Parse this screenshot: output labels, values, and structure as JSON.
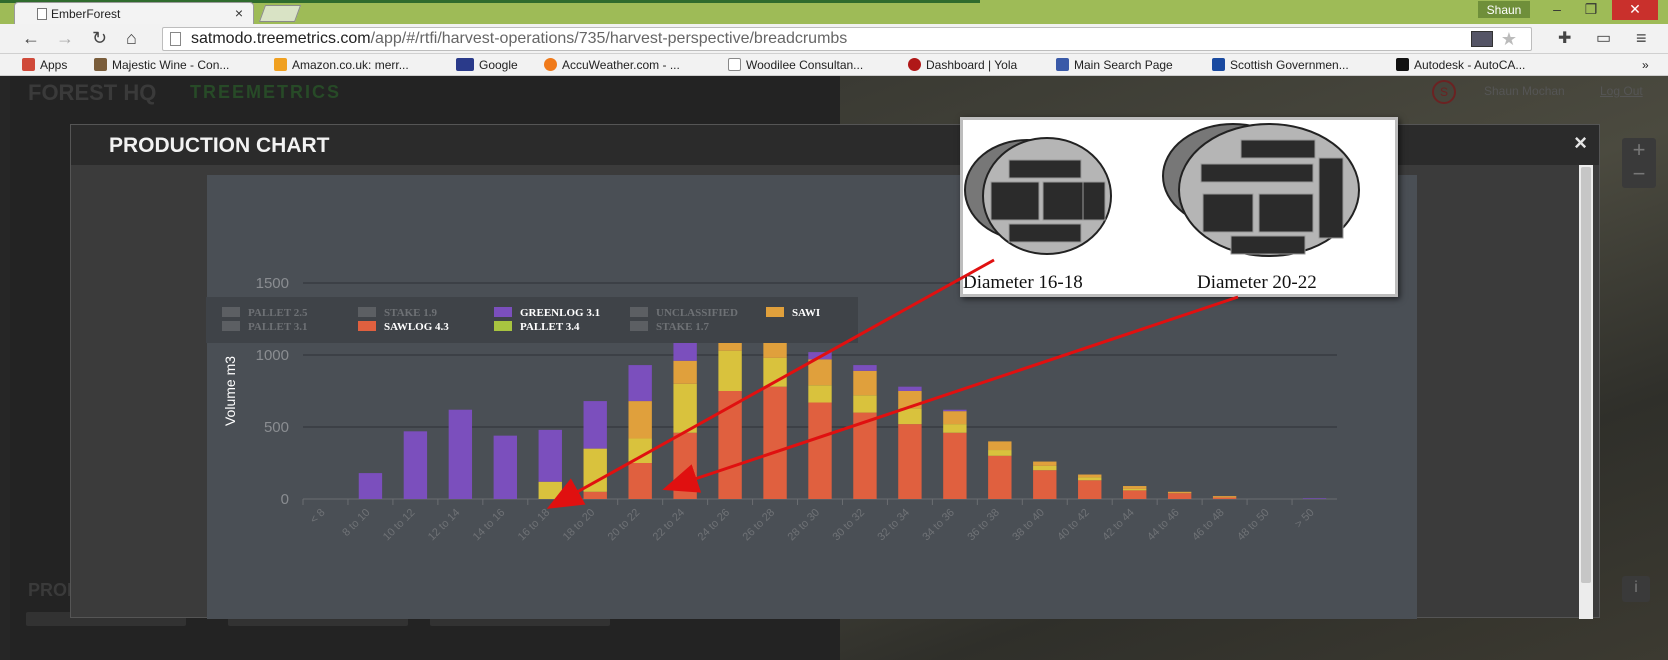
{
  "browser": {
    "tab_title": "EmberForest",
    "tab_close": "×",
    "user_badge": "Shaun",
    "window_controls": {
      "minimize": "–",
      "restore": "❐",
      "close": "✕"
    },
    "url_host": "satmodo.treemetrics.com",
    "url_path": "/app/#/rtfi/harvest-operations/735/harvest-perspective/breadcrumbs",
    "bookmarks": [
      {
        "label": "Apps",
        "color": "#d04a3a"
      },
      {
        "label": "Majestic Wine - Con...",
        "color": "#7a5d3b"
      },
      {
        "label": "Amazon.co.uk: merr...",
        "color": "#f0a020"
      },
      {
        "label": "Google",
        "color": "#2a3a8a"
      },
      {
        "label": "AccuWeather.com - ...",
        "color": "#f07a1a"
      },
      {
        "label": "Woodilee Consultan...",
        "color": "#ffffff"
      },
      {
        "label": "Dashboard | Yola",
        "color": "#b01818"
      },
      {
        "label": "Main Search Page",
        "color": "#3a5aa8"
      },
      {
        "label": "Scottish Governmen...",
        "color": "#1a4aa0"
      },
      {
        "label": "Autodesk - AutoCA...",
        "color": "#111111"
      }
    ],
    "bookmarks_more": "»"
  },
  "app": {
    "brand": "FOREST HQ",
    "brand_sub": "TREEMETRICS",
    "avatar_letter": "S",
    "user_name": "Shaun Mochan",
    "logout": "Log Out",
    "product_breakout": "PRODUCT BREAKOUT:"
  },
  "modal": {
    "title": "PRODUCTION CHART",
    "close": "×"
  },
  "inset": {
    "label_left": "Diameter 16-18",
    "label_right": "Diameter 20-22"
  },
  "colors": {
    "greenlog": "#7b4fbd",
    "sawlog43": "#e0603f",
    "pallet34": "#d9c23d",
    "sawlog_other": "#e0a03c",
    "disabled": "#5c5f63",
    "annotation": "#e01010"
  },
  "chart_data": {
    "type": "bar",
    "stacked": true,
    "ylabel": "Volume m3",
    "ylim": [
      0,
      1500
    ],
    "yticks": [
      "0",
      "500",
      "1000",
      "1500"
    ],
    "grid": true,
    "legend_position": "top-left",
    "categories": [
      "< 8",
      "8 to 10",
      "10 to 12",
      "12 to 14",
      "14 to 16",
      "16 to 18",
      "18 to 20",
      "20 to 22",
      "22 to 24",
      "24 to 26",
      "26 to 28",
      "28 to 30",
      "30 to 32",
      "32 to 34",
      "34 to 36",
      "36 to 38",
      "38 to 40",
      "40 to 42",
      "42 to 44",
      "44 to 46",
      "46 to 48",
      "48 to 50",
      "> 50"
    ],
    "legend": [
      {
        "name": "PALLET 2.5",
        "active": false
      },
      {
        "name": "PALLET 3.1",
        "active": false
      },
      {
        "name": "STAKE 1.9",
        "active": false
      },
      {
        "name": "SAWLOG 4.3",
        "active": true,
        "color": "#e0603f"
      },
      {
        "name": "GREENLOG 3.1",
        "active": true,
        "color": "#7b4fbd"
      },
      {
        "name": "PALLET 3.4",
        "active": true,
        "color": "#a8c440"
      },
      {
        "name": "UNCLASSIFIED",
        "active": false
      },
      {
        "name": "STAKE 1.7",
        "active": false
      },
      {
        "name": "SAWI",
        "active": true,
        "color": "#e0a03c"
      }
    ],
    "series": [
      {
        "name": "SAWLOG 4.3",
        "color": "#e0603f",
        "values": [
          0,
          0,
          0,
          0,
          0,
          0,
          50,
          250,
          460,
          750,
          780,
          670,
          600,
          520,
          460,
          300,
          200,
          130,
          60,
          40,
          10,
          0,
          0
        ]
      },
      {
        "name": "PALLET 3.4",
        "color": "#d9c23d",
        "values": [
          0,
          0,
          0,
          0,
          0,
          120,
          300,
          170,
          340,
          280,
          200,
          120,
          120,
          110,
          60,
          40,
          30,
          20,
          10,
          0,
          0,
          0,
          0
        ]
      },
      {
        "name": "SAWI",
        "color": "#e0a03c",
        "values": [
          0,
          0,
          0,
          0,
          0,
          0,
          0,
          260,
          160,
          220,
          230,
          180,
          170,
          120,
          90,
          60,
          30,
          20,
          20,
          10,
          10,
          0,
          0
        ]
      },
      {
        "name": "GREENLOG 3.1",
        "color": "#7b4fbd",
        "values": [
          0,
          180,
          470,
          620,
          440,
          360,
          330,
          250,
          190,
          150,
          100,
          50,
          40,
          30,
          10,
          0,
          0,
          0,
          0,
          0,
          0,
          0,
          5
        ]
      }
    ]
  }
}
